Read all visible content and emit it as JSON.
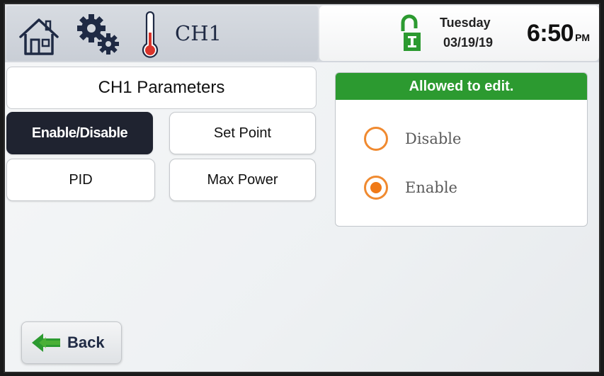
{
  "header": {
    "channel_title": "CH1",
    "day": "Tuesday",
    "date": "03/19/19",
    "time": "6:50",
    "ampm": "PM",
    "icons": [
      "home-icon",
      "gear-icon",
      "thermometer-icon",
      "lock-icon"
    ]
  },
  "parameters": {
    "title": "CH1 Parameters",
    "buttons": {
      "enable_disable": "Enable/Disable",
      "set_point": "Set Point",
      "pid": "PID",
      "max_power": "Max Power"
    },
    "active_button": "Enable/Disable"
  },
  "edit_panel": {
    "header": "Allowed to edit.",
    "options": [
      {
        "label": "Disable",
        "selected": false
      },
      {
        "label": "Enable",
        "selected": true
      }
    ]
  },
  "back": {
    "label": "Back"
  },
  "colors": {
    "accent_green": "#2c9a30",
    "radio_orange": "#f08a30",
    "active_button_bg": "#1f2330"
  }
}
